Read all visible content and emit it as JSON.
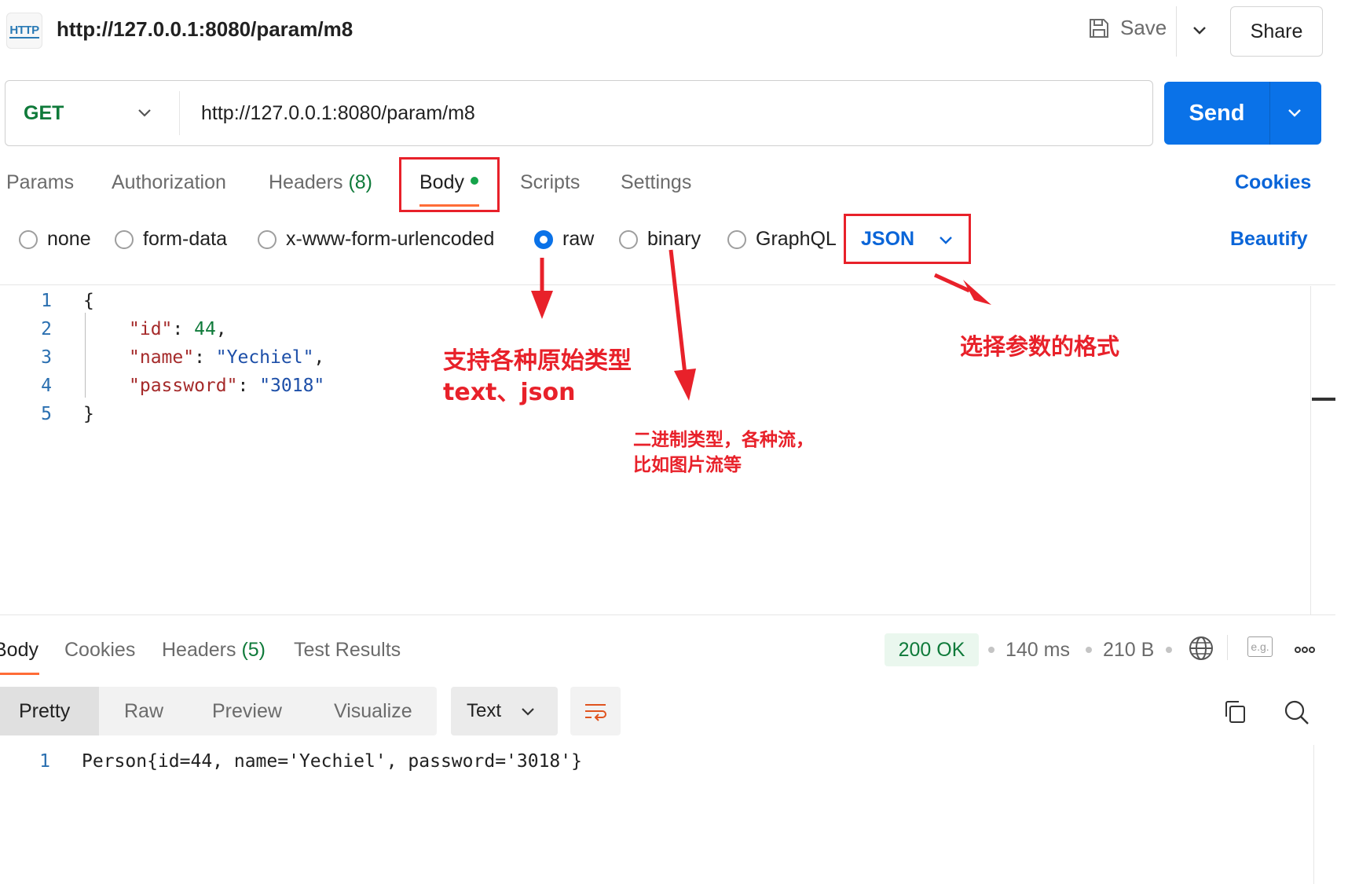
{
  "header": {
    "http_badge": "HTTP",
    "title": "http://127.0.0.1:8080/param/m8",
    "save_label": "Save",
    "share_label": "Share"
  },
  "request": {
    "method": "GET",
    "url": "http://127.0.0.1:8080/param/m8",
    "send_label": "Send"
  },
  "tabs": {
    "params": "Params",
    "authorization": "Authorization",
    "headers": "Headers",
    "headers_count": "(8)",
    "body": "Body",
    "scripts": "Scripts",
    "settings": "Settings",
    "cookies": "Cookies"
  },
  "body_types": {
    "none": "none",
    "form_data": "form-data",
    "urlencoded": "x-www-form-urlencoded",
    "raw": "raw",
    "binary": "binary",
    "graphql": "GraphQL",
    "selected": "raw",
    "format": "JSON",
    "beautify": "Beautify"
  },
  "editor": {
    "line_numbers": [
      "1",
      "2",
      "3",
      "4",
      "5"
    ],
    "open_brace": "{",
    "close_brace": "}",
    "id_key": "\"id\"",
    "id_value": "44",
    "name_key": "\"name\"",
    "name_value": "\"Yechiel\"",
    "password_key": "\"password\"",
    "password_value": "\"3018\""
  },
  "response": {
    "tabs": {
      "body": "Body",
      "cookies": "Cookies",
      "headers": "Headers",
      "headers_count": "(5)",
      "test_results": "Test Results"
    },
    "status": "200 OK",
    "time": "140 ms",
    "size": "210 B",
    "example_badge": "e.g.",
    "views": {
      "pretty": "Pretty",
      "raw": "Raw",
      "preview": "Preview",
      "visualize": "Visualize"
    },
    "format": "Text",
    "line_number": "1",
    "content": "Person{id=44, name='Yechiel', password='3018'}"
  },
  "annotations": {
    "raw_note_line1": "支持各种原始类型",
    "raw_note_line2": "text、json",
    "binary_note_line1": "二进制类型，各种流，",
    "binary_note_line2": "比如图片流等",
    "format_note": "选择参数的格式"
  },
  "colors": {
    "primary_blue": "#0a72e8",
    "link_blue": "#0a65d8",
    "success_green": "#0f7a3a",
    "annotation_red": "#e8212a",
    "active_tab_underline": "#ff6c37"
  },
  "icons": {
    "save": "save-icon",
    "globe": "globe-icon",
    "more": "more-icon",
    "copy": "copy-icon",
    "search": "search-icon",
    "wrap": "wrap-lines-icon"
  }
}
